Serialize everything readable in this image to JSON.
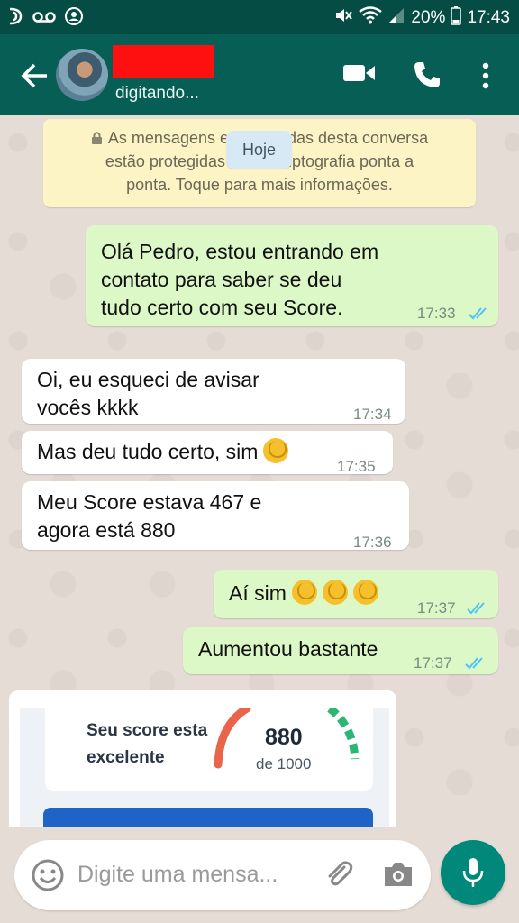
{
  "status_bar": {
    "battery": "20%",
    "time": "17:43"
  },
  "header": {
    "status": "digitando..."
  },
  "system_message": {
    "chip": "Hoje",
    "text_line1": "As mensagens e             das desta conversa",
    "text_line2": "estão protegidas c          riptografia ponta a",
    "text_line3": "ponta. Toque para mais informações."
  },
  "messages": [
    {
      "direction": "out",
      "lines": [
        "Olá Pedro, estou entrando em",
        "contato para saber se deu",
        "tudo certo com seu Score."
      ],
      "time": "17:33"
    },
    {
      "direction": "in",
      "lines": [
        "Oi, eu esqueci de avisar",
        "vocês kkkk"
      ],
      "time": "17:34"
    },
    {
      "direction": "in",
      "lines": [
        "Mas deu tudo certo, sim"
      ],
      "time": "17:35"
    },
    {
      "direction": "in",
      "lines": [
        "Meu Score estava 467 e",
        "agora está 880"
      ],
      "time": "17:36"
    },
    {
      "direction": "out",
      "lines": [
        "Aí sim"
      ],
      "time": "17:37"
    },
    {
      "direction": "out",
      "lines": [
        "Aumentou bastante"
      ],
      "time": "17:37"
    }
  ],
  "image_card": {
    "line1": "Seu score esta",
    "line2": "excelente",
    "score": "880",
    "out_of": "de 1000"
  },
  "input": {
    "placeholder": "Digite uma mensa..."
  },
  "colors": {
    "header": "#075e54",
    "outgoing": "#dcf8c6",
    "incoming": "#ffffff",
    "ticks": "#4fc3f7",
    "accent": "#00897b"
  }
}
